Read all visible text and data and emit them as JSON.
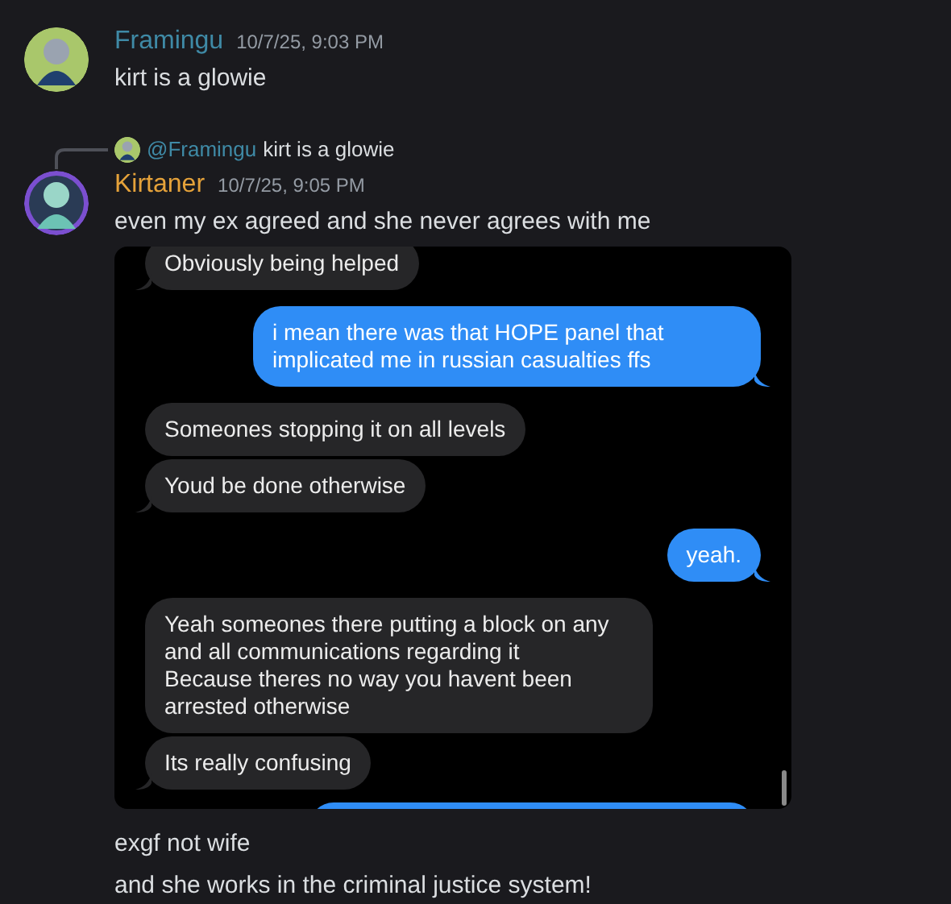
{
  "messages": [
    {
      "author": "Framingu",
      "color": "#3f8aa6",
      "timestamp": "10/7/25, 9:03 PM",
      "avatar_ring": false,
      "lines": [
        "kirt is a glowie"
      ]
    },
    {
      "author": "Kirtaner",
      "color": "#e5a23a",
      "timestamp": "10/7/25, 9:05 PM",
      "avatar_ring": true,
      "reply": {
        "author": "@Framingu",
        "text": "kirt is a glowie"
      },
      "lines": [
        "even my ex agreed and she never agrees with me"
      ],
      "attachment": {
        "bubbles": [
          {
            "kind": "received",
            "text": "Obviously being helped",
            "tail": true
          },
          {
            "kind": "sent",
            "text": "i mean there was that HOPE panel that implicated me in russian casualties ffs",
            "tail": true
          },
          {
            "kind": "received",
            "text": "Someones stopping it on all levels",
            "tail": false
          },
          {
            "kind": "received",
            "text": "Youd be done otherwise",
            "tail": true
          },
          {
            "kind": "sent",
            "text": "yeah.",
            "tail": true
          },
          {
            "kind": "received",
            "lines": [
              "Yeah someones there putting a block on any and all communications regarding it",
              "Because theres no way you havent been arrested otherwise"
            ],
            "tail": false
          },
          {
            "kind": "received",
            "text": "Its really confusing",
            "tail": true
          }
        ],
        "cut_bubble": {
          "kind": "sent"
        }
      }
    },
    {
      "continuation": true,
      "lines": [
        "exgf not wife",
        "and she works in the criminal justice system!"
      ]
    }
  ]
}
